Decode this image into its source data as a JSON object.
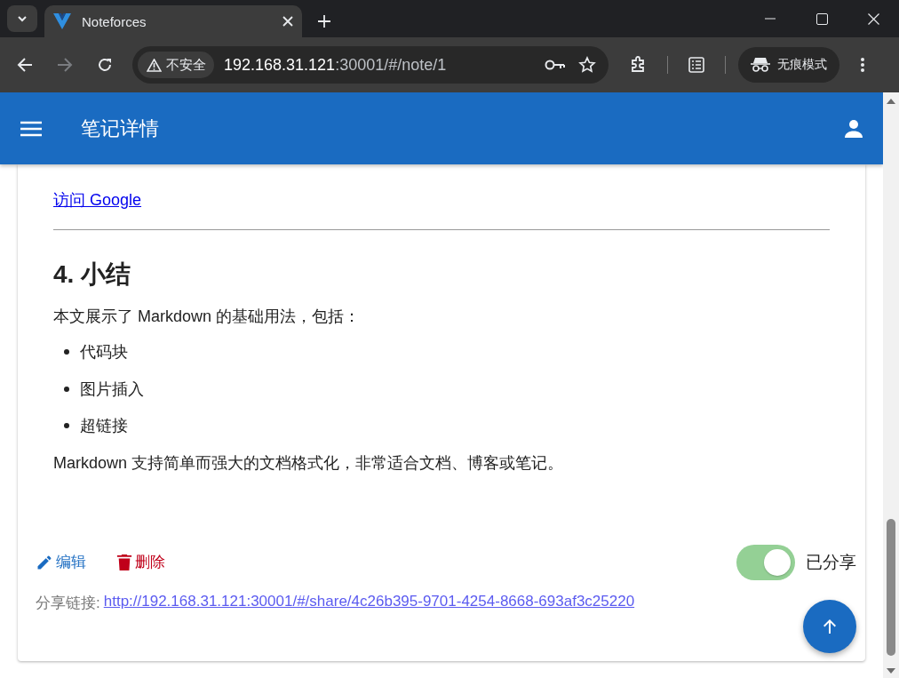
{
  "browser": {
    "tab": {
      "title": "Noteforces"
    },
    "forward_disabled": true,
    "address_bar": {
      "security": "不安全",
      "host": "192.168.31.121",
      "path": ":30001/#/note/1"
    },
    "profile": {
      "label": "无痕模式"
    }
  },
  "app_bar": {
    "title": "笔记详情"
  },
  "note": {
    "blocks": [
      {
        "kind": "link",
        "text": "访问 Google"
      },
      {
        "kind": "rule"
      },
      {
        "kind": "heading",
        "text": "4. 小结"
      },
      {
        "kind": "paragraph",
        "text": "本文展示了 Markdown 的基础用法，包括："
      },
      {
        "kind": "list",
        "items": [
          "代码块",
          "图片插入",
          "超链接"
        ]
      },
      {
        "kind": "paragraph",
        "text": "Markdown 支持简单而强大的文档格式化，非常适合文档、博客或笔记。"
      }
    ],
    "actions": [
      {
        "kind": "edit",
        "label": "编辑"
      },
      {
        "kind": "delete",
        "label": "删除"
      }
    ],
    "share": {
      "on": true,
      "label": "已分享",
      "link_label": "分享链接:",
      "link": "http://192.168.31.121:30001/#/share/4c26b395-9701-4254-8668-693af3c25220"
    }
  }
}
